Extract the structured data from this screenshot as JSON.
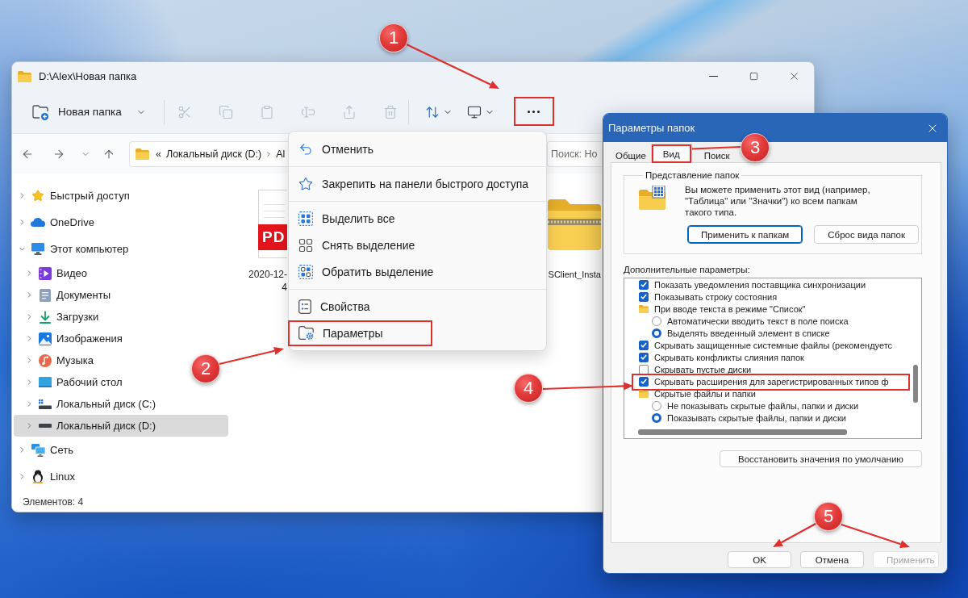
{
  "explorer": {
    "title": "D:\\Alex\\Новая папка",
    "toolbar": {
      "new_folder": "Новая папка",
      "tools": [
        {
          "kind": "cut",
          "disabled": true,
          "highlighted": false
        },
        {
          "kind": "copy",
          "disabled": true,
          "highlighted": false
        },
        {
          "kind": "paste",
          "disabled": true,
          "highlighted": false
        },
        {
          "kind": "rename",
          "disabled": true,
          "highlighted": false
        },
        {
          "kind": "share",
          "disabled": true,
          "highlighted": false
        },
        {
          "kind": "delete",
          "disabled": true,
          "highlighted": false
        },
        {
          "kind": "sort",
          "disabled": false,
          "highlighted": false
        },
        {
          "kind": "view",
          "disabled": false,
          "highlighted": false
        },
        {
          "kind": "more",
          "disabled": false,
          "highlighted": true
        }
      ]
    },
    "nav_buttons": [
      {
        "kind": "back"
      },
      {
        "kind": "forward"
      },
      {
        "kind": "recent"
      },
      {
        "kind": "up"
      }
    ],
    "address": {
      "overflow": "«",
      "crumbs": [
        "Локальный диск (D:)",
        "Al"
      ]
    },
    "search": {
      "placeholder": "Поиск: Но"
    },
    "sidebar": [
      {
        "label": "Быстрый доступ",
        "kind": "star",
        "expanded": false,
        "selected": false
      },
      {
        "label": "OneDrive",
        "kind": "cloud",
        "expanded": false,
        "selected": false
      },
      {
        "label": "Этот компьютер",
        "kind": "computer",
        "expanded": true,
        "selected": false,
        "children": [
          {
            "label": "Видео",
            "kind": "video",
            "expanded": false,
            "selected": false
          },
          {
            "label": "Документы",
            "kind": "documents",
            "expanded": false,
            "selected": false
          },
          {
            "label": "Загрузки",
            "kind": "downloads",
            "expanded": false,
            "selected": false
          },
          {
            "label": "Изображения",
            "kind": "images",
            "expanded": false,
            "selected": false
          },
          {
            "label": "Музыка",
            "kind": "music",
            "expanded": false,
            "selected": false
          },
          {
            "label": "Рабочий стол",
            "kind": "desktop",
            "expanded": false,
            "selected": false
          },
          {
            "label": "Локальный диск (C:)",
            "kind": "system_drive",
            "expanded": false,
            "selected": false
          },
          {
            "label": "Локальный диск (D:)",
            "kind": "drive",
            "expanded": false,
            "selected": true
          }
        ]
      },
      {
        "label": "Сеть",
        "kind": "network",
        "expanded": false,
        "selected": false
      },
      {
        "label": "Linux",
        "kind": "penguin",
        "expanded": false,
        "selected": false
      }
    ],
    "files": [
      {
        "kind": "pdf",
        "type_label": "PD",
        "name_lines": [
          "2020-12-",
          "4"
        ]
      },
      {
        "kind": "zip",
        "name_lines": [
          "SClient_Insta"
        ]
      }
    ],
    "status_bar": "Элементов: 4"
  },
  "context_menu": {
    "groups": [
      [
        {
          "kind": "undo",
          "label": "Отменить",
          "highlighted": false
        }
      ],
      [
        {
          "kind": "pin",
          "label": "Закрепить на панели быстрого доступа",
          "highlighted": false
        }
      ],
      [
        {
          "kind": "select_all",
          "label": "Выделить все",
          "highlighted": false
        },
        {
          "kind": "select_none",
          "label": "Снять выделение",
          "highlighted": false
        },
        {
          "kind": "invert",
          "label": "Обратить выделение",
          "highlighted": false
        }
      ],
      [
        {
          "kind": "properties",
          "label": "Свойства",
          "highlighted": false
        },
        {
          "kind": "options",
          "label": "Параметры",
          "highlighted": true
        }
      ]
    ]
  },
  "dialog": {
    "title": "Параметры папок",
    "tabs": [
      {
        "label": "Общие",
        "selected": false,
        "highlighted": false
      },
      {
        "label": "Вид",
        "selected": true,
        "highlighted": true
      },
      {
        "label": "Поиск",
        "selected": false,
        "highlighted": false
      }
    ],
    "folder_views": {
      "legend": "Представление папок",
      "description_lines": [
        "Вы можете применить этот вид (например,",
        "\"Таблица\" или \"Значки\") ко всем папкам",
        "такого типа."
      ],
      "buttons": [
        {
          "label": "Применить к папкам",
          "focused": true
        },
        {
          "label": "Сброс вида папок",
          "focused": false
        }
      ]
    },
    "advanced": {
      "label": "Дополнительные параметры:",
      "items": [
        {
          "kind": "checkbox",
          "label": "Показать уведомления поставщика синхронизации",
          "checked": true,
          "highlighted": false
        },
        {
          "kind": "checkbox",
          "label": "Показывать строку состояния",
          "checked": true,
          "highlighted": false
        },
        {
          "kind": "group",
          "label": "При вводе текста в режиме \"Список\"",
          "highlighted": false,
          "children": [
            {
              "kind": "radio",
              "label": "Автоматически вводить текст в поле поиска",
              "selected": false
            },
            {
              "kind": "radio",
              "label": "Выделять введенный элемент в списке",
              "selected": true
            }
          ]
        },
        {
          "kind": "checkbox",
          "label": "Скрывать защищенные системные файлы (рекомендуетс",
          "checked": true,
          "highlighted": false
        },
        {
          "kind": "checkbox",
          "label": "Скрывать конфликты слияния папок",
          "checked": true,
          "highlighted": false
        },
        {
          "kind": "checkbox",
          "label": "Скрывать пустые диски",
          "checked": false,
          "highlighted": false
        },
        {
          "kind": "checkbox",
          "label": "Скрывать расширения для зарегистрированных типов ф",
          "checked": true,
          "highlighted": true
        },
        {
          "kind": "group",
          "label": "Скрытые файлы и папки",
          "highlighted": false,
          "children": [
            {
              "kind": "radio",
              "label": "Не показывать скрытые файлы, папки и диски",
              "selected": false
            },
            {
              "kind": "radio",
              "label": "Показывать скрытые файлы, папки и диски",
              "selected": true
            }
          ]
        }
      ]
    },
    "restore_button": "Восстановить значения по умолчанию",
    "footer_buttons": [
      {
        "label": "OK",
        "disabled": false
      },
      {
        "label": "Отмена",
        "disabled": false
      },
      {
        "label": "Применить",
        "disabled": true
      }
    ]
  },
  "annotations": [
    {
      "number": "1"
    },
    {
      "number": "2"
    },
    {
      "number": "3"
    },
    {
      "number": "4"
    },
    {
      "number": "5"
    }
  ]
}
